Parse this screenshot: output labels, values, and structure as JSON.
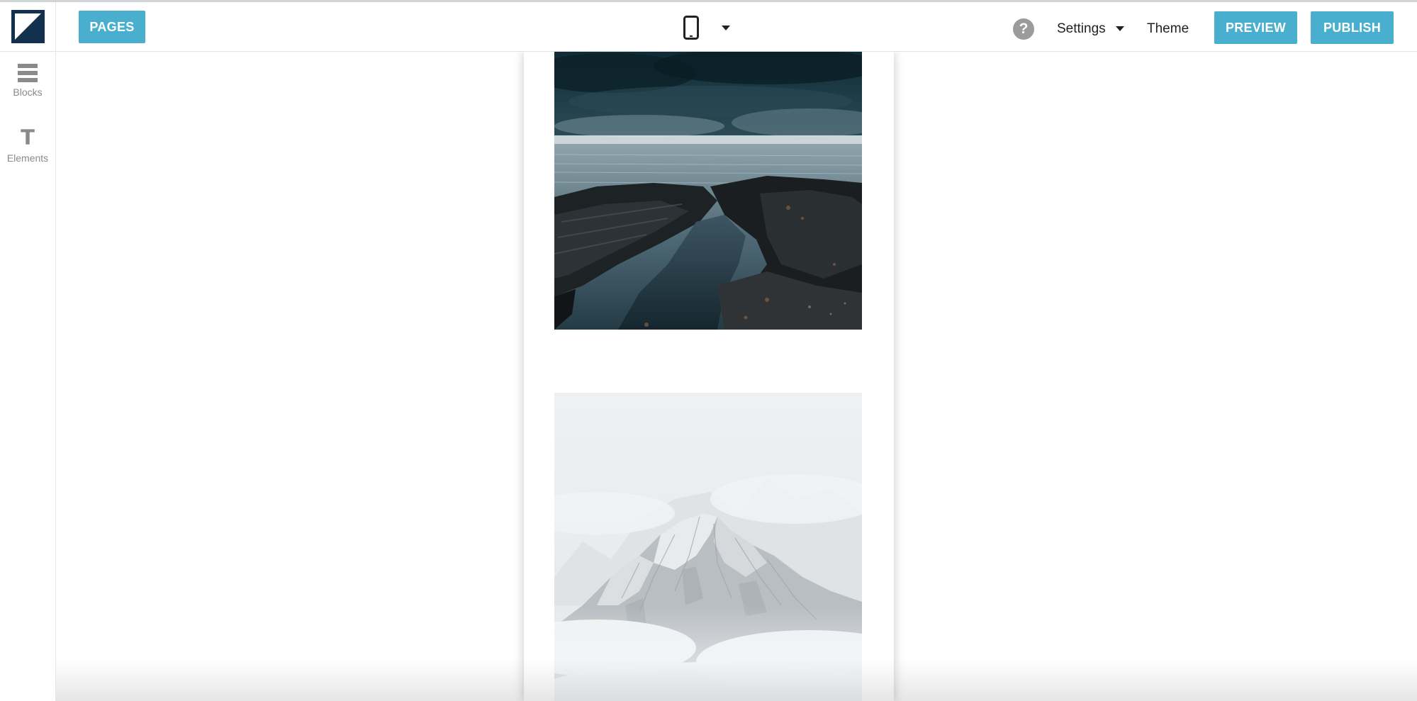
{
  "topbar": {
    "pages_label": "PAGES",
    "device_icon": "mobile-phone-icon",
    "help_icon": "question-circle-icon",
    "help_glyph": "?",
    "settings_label": "Settings",
    "theme_label": "Theme",
    "preview_label": "PREVIEW",
    "publish_label": "PUBLISH"
  },
  "sidebar": {
    "items": [
      {
        "label": "Blocks",
        "icon": "blocks-icon"
      },
      {
        "label": "Elements",
        "icon": "text-icon",
        "glyph": "T"
      }
    ]
  },
  "canvas": {
    "images": [
      {
        "subject": "rocky shoreline under dark stormy clouds"
      },
      {
        "subject": "snowy mountain peak in fog"
      }
    ]
  },
  "colors": {
    "accent": "#4aafcf",
    "logo_navy": "#13304f",
    "icon_gray": "#8a8a8a"
  }
}
